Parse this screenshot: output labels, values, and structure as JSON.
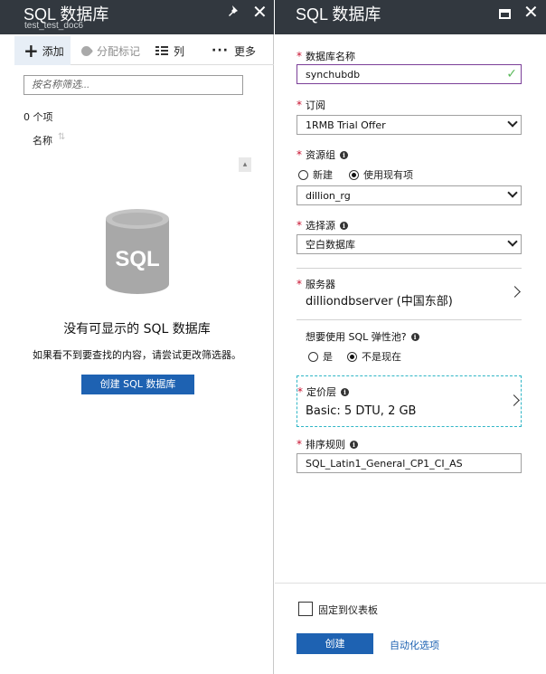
{
  "left": {
    "title": "SQL 数据库",
    "subtitle": "test_test_doc6",
    "commands": {
      "add": "添加",
      "assign_tags": "分配标记",
      "columns": "列",
      "more": "更多"
    },
    "filter_placeholder": "按名称筛选...",
    "count": "0 个项",
    "column_header": "名称",
    "empty_icon_text": "SQL",
    "empty_title": "没有可显示的 SQL 数据库",
    "empty_desc": "如果看不到要查找的内容，请尝试更改筛选器。",
    "create_button": "创建 SQL 数据库"
  },
  "right": {
    "title": "SQL 数据库",
    "db_name": {
      "label": "数据库名称",
      "value": "synchubdb"
    },
    "subscription": {
      "label": "订阅",
      "value": "1RMB Trial Offer"
    },
    "resource_group": {
      "label": "资源组",
      "options": [
        "新建",
        "使用现有项"
      ],
      "selected": "使用现有项",
      "value": "dillion_rg"
    },
    "source": {
      "label": "选择源",
      "value": "空白数据库"
    },
    "server": {
      "label": "服务器",
      "value": "dilliondbserver (中国东部)"
    },
    "elastic_pool": {
      "label": "想要使用 SQL 弹性池?",
      "options": [
        "是",
        "不是现在"
      ],
      "selected": "不是现在"
    },
    "pricing": {
      "label": "定价层",
      "value": "Basic: 5 DTU, 2 GB"
    },
    "collation": {
      "label": "排序规则",
      "value": "SQL_Latin1_General_CP1_CI_AS"
    },
    "pin_label": "固定到仪表板",
    "create_button": "创建",
    "automation_link": "自动化选项"
  },
  "colors": {
    "header_bg": "#32383f",
    "accent_blue": "#1e62b2",
    "required_red": "#c8102e",
    "valid_green": "#5bb95b"
  }
}
